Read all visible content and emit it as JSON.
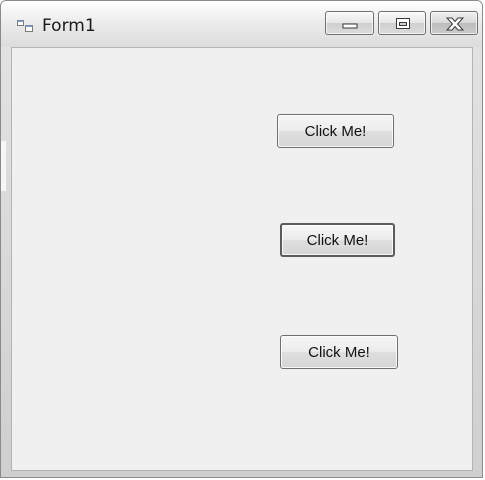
{
  "window": {
    "title": "Form1",
    "icon": "form-window-icon"
  },
  "title_controls": {
    "minimize_icon": "minimize-icon",
    "maximize_icon": "maximize-icon",
    "close_icon": "close-icon"
  },
  "buttons": [
    {
      "label": "Click Me!"
    },
    {
      "label": "Click Me!"
    },
    {
      "label": "Click Me!"
    }
  ]
}
